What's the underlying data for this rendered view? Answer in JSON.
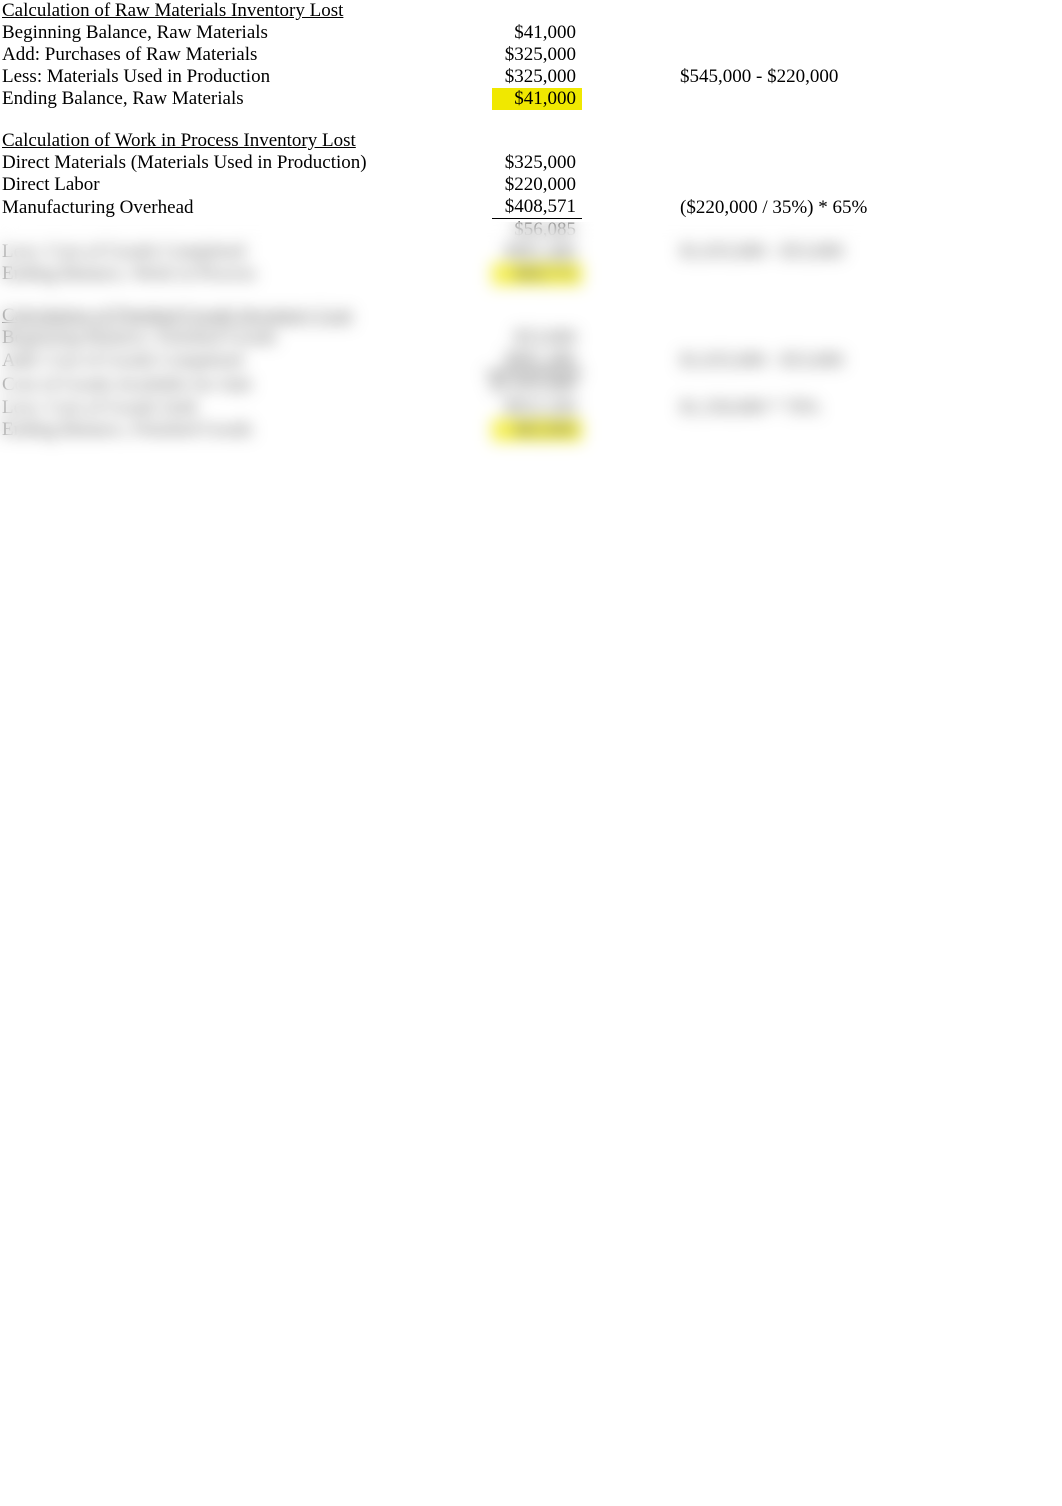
{
  "section1": {
    "title": "Calculation of Raw Materials Inventory Lost",
    "rows": [
      {
        "label": "Beginning Balance, Raw Materials",
        "amount": "$41,000",
        "note": ""
      },
      {
        "label": "Add: Purchases of Raw Materials",
        "amount": "$325,000",
        "note": ""
      },
      {
        "label": "Less: Materials Used in Production",
        "amount": "$325,000",
        "note": "$545,000 - $220,000"
      },
      {
        "label": "Ending Balance, Raw Materials",
        "amount": "$41,000",
        "note": "",
        "highlight": true
      }
    ]
  },
  "section2": {
    "title": "Calculation of Work in Process Inventory Lost",
    "rows": [
      {
        "label": "Direct Materials (Materials Used in Production)",
        "amount": "$325,000",
        "note": ""
      },
      {
        "label": "Direct Labor",
        "amount": "$220,000",
        "note": ""
      },
      {
        "label": "Manufacturing Overhead",
        "amount": "$408,571",
        "note": "($220,000 / 35%) * 65%",
        "underline_amount": true
      },
      {
        "label": "",
        "amount": "$56,085",
        "note": ""
      },
      {
        "label": "Less: Cost of Goods Completed",
        "amount": "$981,486",
        "note": "$1,035,000 - $53,000"
      },
      {
        "label": "Ending Balance, Work in Process",
        "amount": "$68,771",
        "note": "",
        "highlight": true
      }
    ]
  },
  "section3": {
    "title": "Calculation of Finished Goods Inventory Lost",
    "rows": [
      {
        "label": "Beginning Balance, Finished Goods",
        "amount": "$53,000",
        "note": ""
      },
      {
        "label": "Add: Cost of Goods Completed",
        "amount": "$981,486",
        "note": "$1,035,000 - $53,000",
        "underline_amount": true
      },
      {
        "label": "Cost of Goods Available for Sale",
        "amount": "$1,035,000",
        "note": "",
        "double_top": true
      },
      {
        "label": "Less: Cost of Goods Sold",
        "amount": "$952,200",
        "note": "$1,350,000 * 70%"
      },
      {
        "label": "Ending Balance, Finished Goods",
        "amount": "$82,800",
        "note": "",
        "highlight": true
      }
    ]
  }
}
